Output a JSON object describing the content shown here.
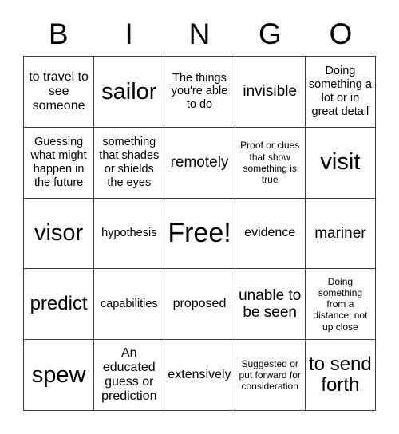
{
  "card": {
    "title": "BINGO Card",
    "header_letters": [
      "B",
      "I",
      "N",
      "G",
      "O"
    ],
    "columns": 5,
    "rows": 5,
    "free_space": "Free!",
    "free_space_position": "center",
    "border_color": "#3a3a3a",
    "background_color": "#ffffff",
    "text_color": "#000000",
    "cells": [
      [
        {
          "text": "to travel to see someone",
          "size": "md"
        },
        {
          "text": "sailor",
          "size": "2xl"
        },
        {
          "text": "The things you're able to do",
          "size": "sm"
        },
        {
          "text": "invisible",
          "size": "lg"
        },
        {
          "text": "Doing something a lot or in great detail",
          "size": "sm"
        }
      ],
      [
        {
          "text": "Guessing what might happen in the future",
          "size": "sm"
        },
        {
          "text": "something that shades or shields the eyes",
          "size": "sm"
        },
        {
          "text": "remotely",
          "size": "lg"
        },
        {
          "text": "Proof or clues that show something is true",
          "size": "xs"
        },
        {
          "text": "visit",
          "size": "2xl"
        }
      ],
      [
        {
          "text": "visor",
          "size": "2xl"
        },
        {
          "text": "hypothesis",
          "size": "sm"
        },
        {
          "text": "Free!",
          "size": "3xl"
        },
        {
          "text": "evidence",
          "size": "md"
        },
        {
          "text": "mariner",
          "size": "lg"
        }
      ],
      [
        {
          "text": "predict",
          "size": "xl"
        },
        {
          "text": "capabilities",
          "size": "sm"
        },
        {
          "text": "proposed",
          "size": "md"
        },
        {
          "text": "unable to be seen",
          "size": "lg"
        },
        {
          "text": "Doing something from a distance, not up close",
          "size": "xs"
        }
      ],
      [
        {
          "text": "spew",
          "size": "2xl"
        },
        {
          "text": "An educated guess or prediction",
          "size": "md"
        },
        {
          "text": "extensively",
          "size": "md"
        },
        {
          "text": "Suggested or put forward for consideration",
          "size": "xs"
        },
        {
          "text": "to send forth",
          "size": "xl"
        }
      ]
    ]
  }
}
